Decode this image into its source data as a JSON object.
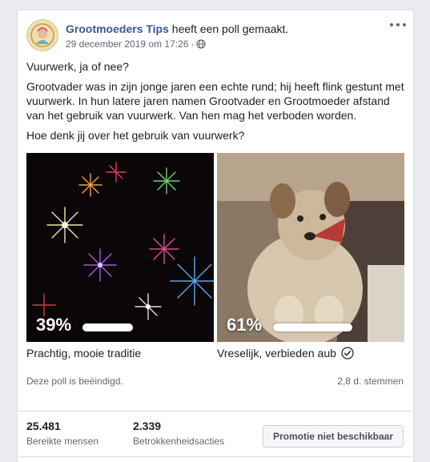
{
  "post": {
    "page_name": "Grootmoeders Tips",
    "action_text": "heeft een poll gemaakt.",
    "timestamp": "29 december 2019 om 17:26",
    "separator": "·",
    "privacy_icon": "globe-icon",
    "more_icon": "more-options-icon",
    "paragraphs": [
      "Vuurwerk, ja of nee?",
      "Grootvader was in zijn jonge jaren een echte rund; hij heeft flink gestunt met vuurwerk. In hun latere jaren namen Grootvader en Grootmoeder afstand van het gebruik van vuurwerk. Van hen mag het verboden worden.",
      "Hoe denk jij over het gebruik van vuurwerk?"
    ]
  },
  "poll": {
    "options": [
      {
        "percent_label": "39%",
        "share": 0.39,
        "label": "Prachtig, mooie traditie",
        "image": "fireworks-image",
        "selected": false
      },
      {
        "percent_label": "61%",
        "share": 0.61,
        "label": "Vreselijk, verbieden aub",
        "image": "dog-image",
        "selected": true
      }
    ],
    "status": "Deze poll is beëindigd.",
    "votes": "2,8 d. stemmen"
  },
  "insights": {
    "reach_value": "25.481",
    "reach_label": "Bereikte mensen",
    "engagement_value": "2.339",
    "engagement_label": "Betrokkenheidsacties",
    "promo_button": "Promotie niet beschikbaar"
  },
  "colors": {
    "link": "#385898",
    "secondary_text": "#606770",
    "background": "#e9ebee"
  }
}
